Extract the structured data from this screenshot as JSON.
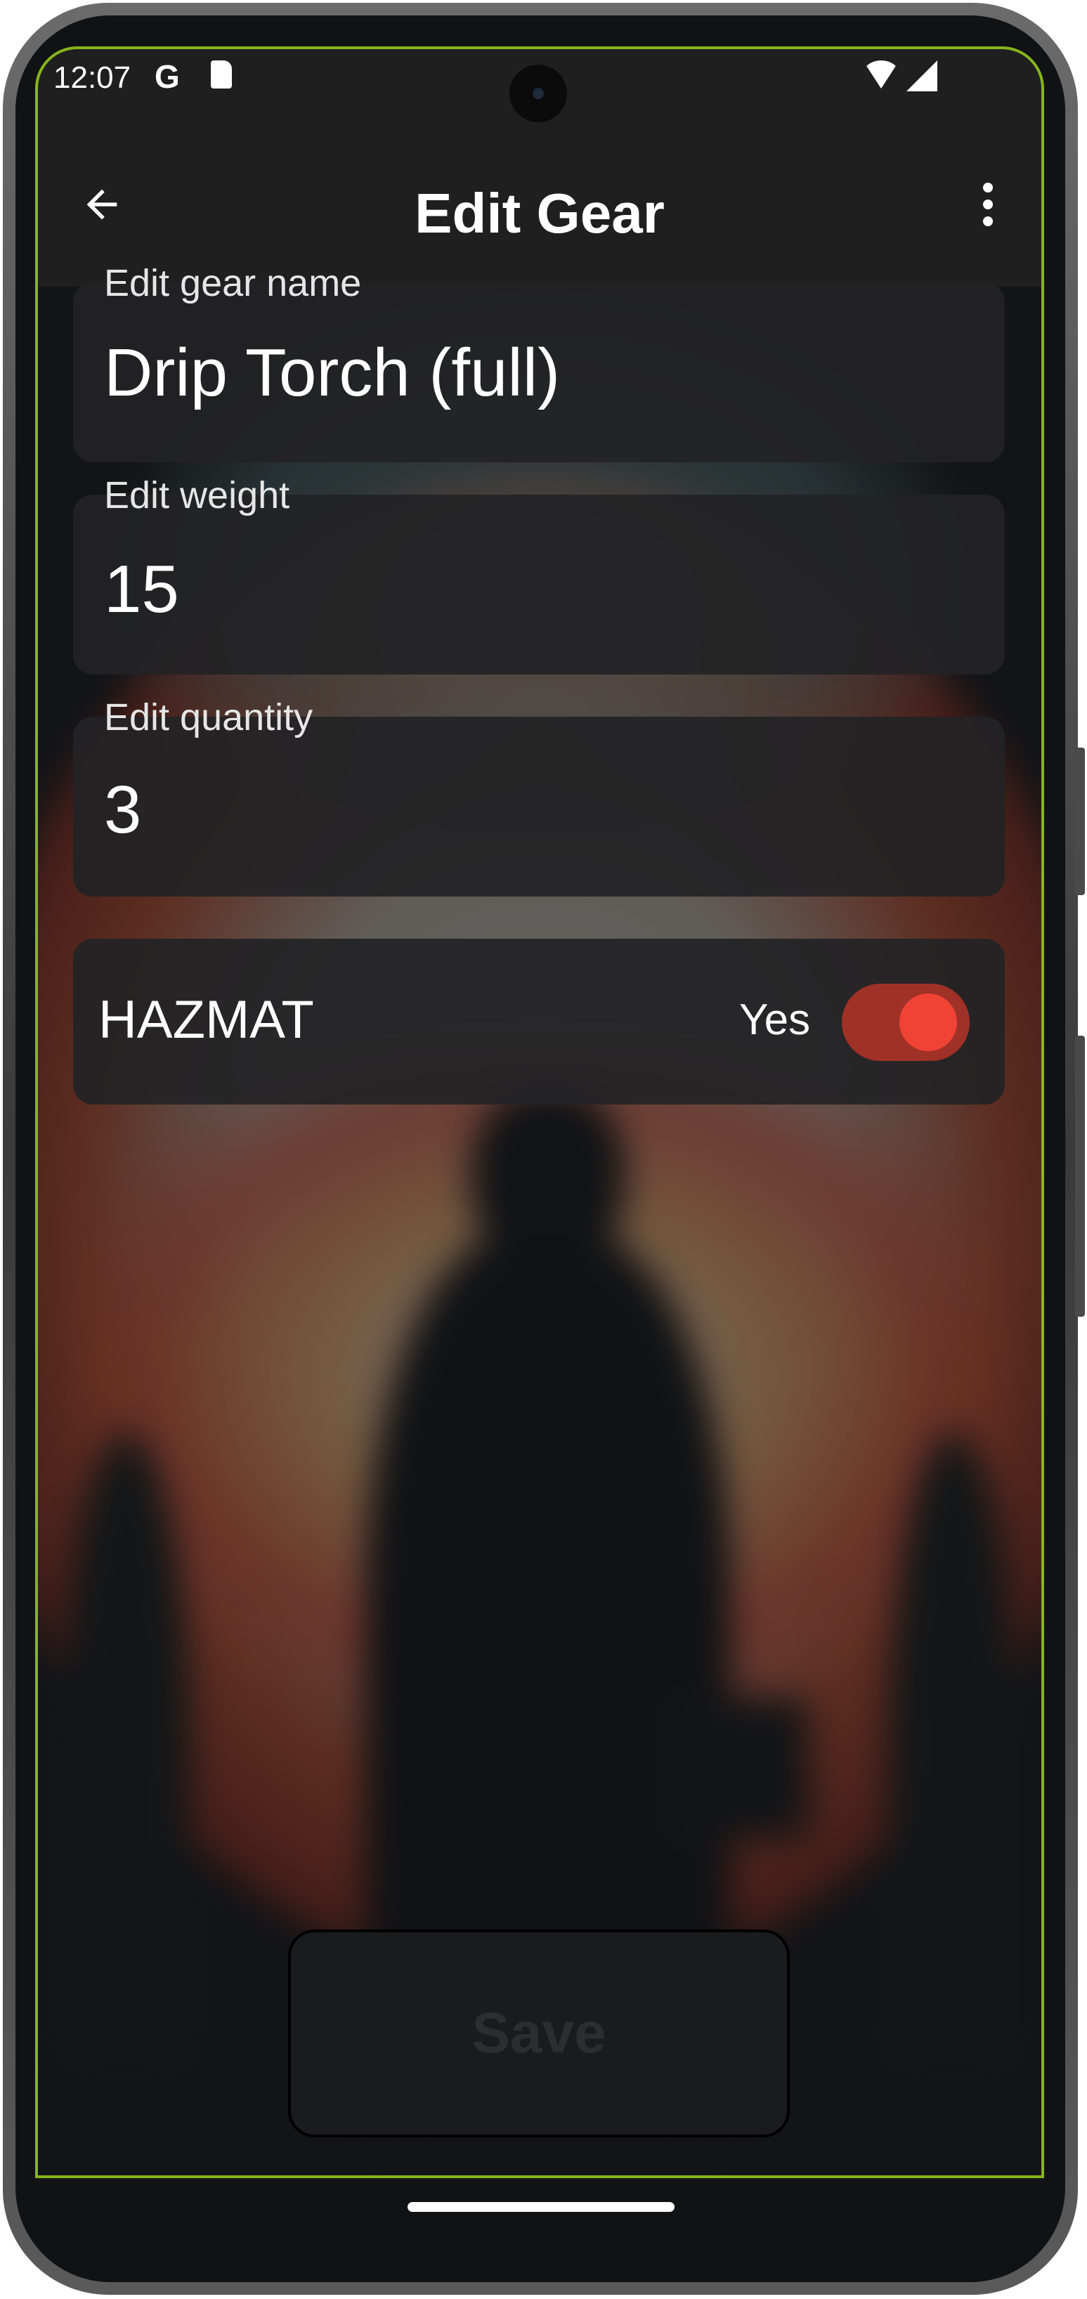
{
  "status_bar": {
    "time": "12:07",
    "icons": [
      "google-icon",
      "sd-card-icon",
      "wifi-icon",
      "signal-icon"
    ]
  },
  "app_bar": {
    "title": "Edit Gear",
    "back_icon": "arrow-back-icon",
    "menu_icon": "more-vert-icon"
  },
  "form": {
    "name": {
      "label": "Edit gear name",
      "value": "Drip Torch (full)"
    },
    "weight": {
      "label": "Edit weight",
      "value": "15"
    },
    "quantity": {
      "label": "Edit quantity",
      "value": "3"
    },
    "hazmat": {
      "label": "HAZMAT",
      "state_text": "Yes",
      "checked": true
    }
  },
  "save_button": {
    "label": "Save"
  },
  "colors": {
    "accent": "#f14236",
    "track": "#a03127",
    "surface": "#1f1f20",
    "outline": "#86b51c"
  }
}
